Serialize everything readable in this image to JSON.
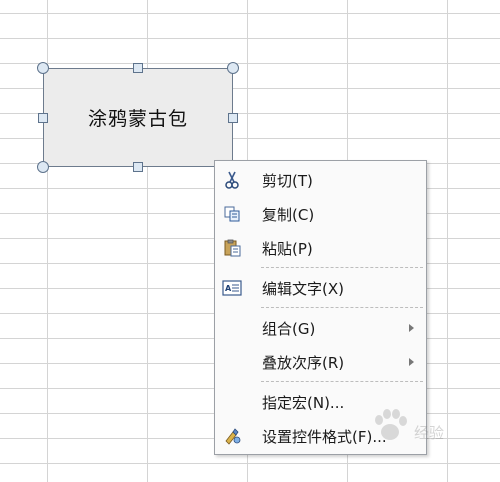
{
  "shape": {
    "text": "涂鸦蒙古包"
  },
  "context_menu": {
    "items": [
      {
        "label": "剪切(T)",
        "icon": "scissors-icon"
      },
      {
        "label": "复制(C)",
        "icon": "copy-icon"
      },
      {
        "label": "粘贴(P)",
        "icon": "paste-icon"
      },
      {
        "label": "编辑文字(X)",
        "icon": "edit-text-icon"
      },
      {
        "label": "组合(G)",
        "has_submenu": true
      },
      {
        "label": "叠放次序(R)",
        "has_submenu": true
      },
      {
        "label": "指定宏(N)..."
      },
      {
        "label": "设置控件格式(F)...",
        "icon": "format-control-icon"
      }
    ]
  },
  "watermark": {
    "text": "经验"
  },
  "colors": {
    "menu_bg": "#fafafa",
    "shape_fill": "#ececec",
    "grid_line": "#d4d4d4"
  }
}
